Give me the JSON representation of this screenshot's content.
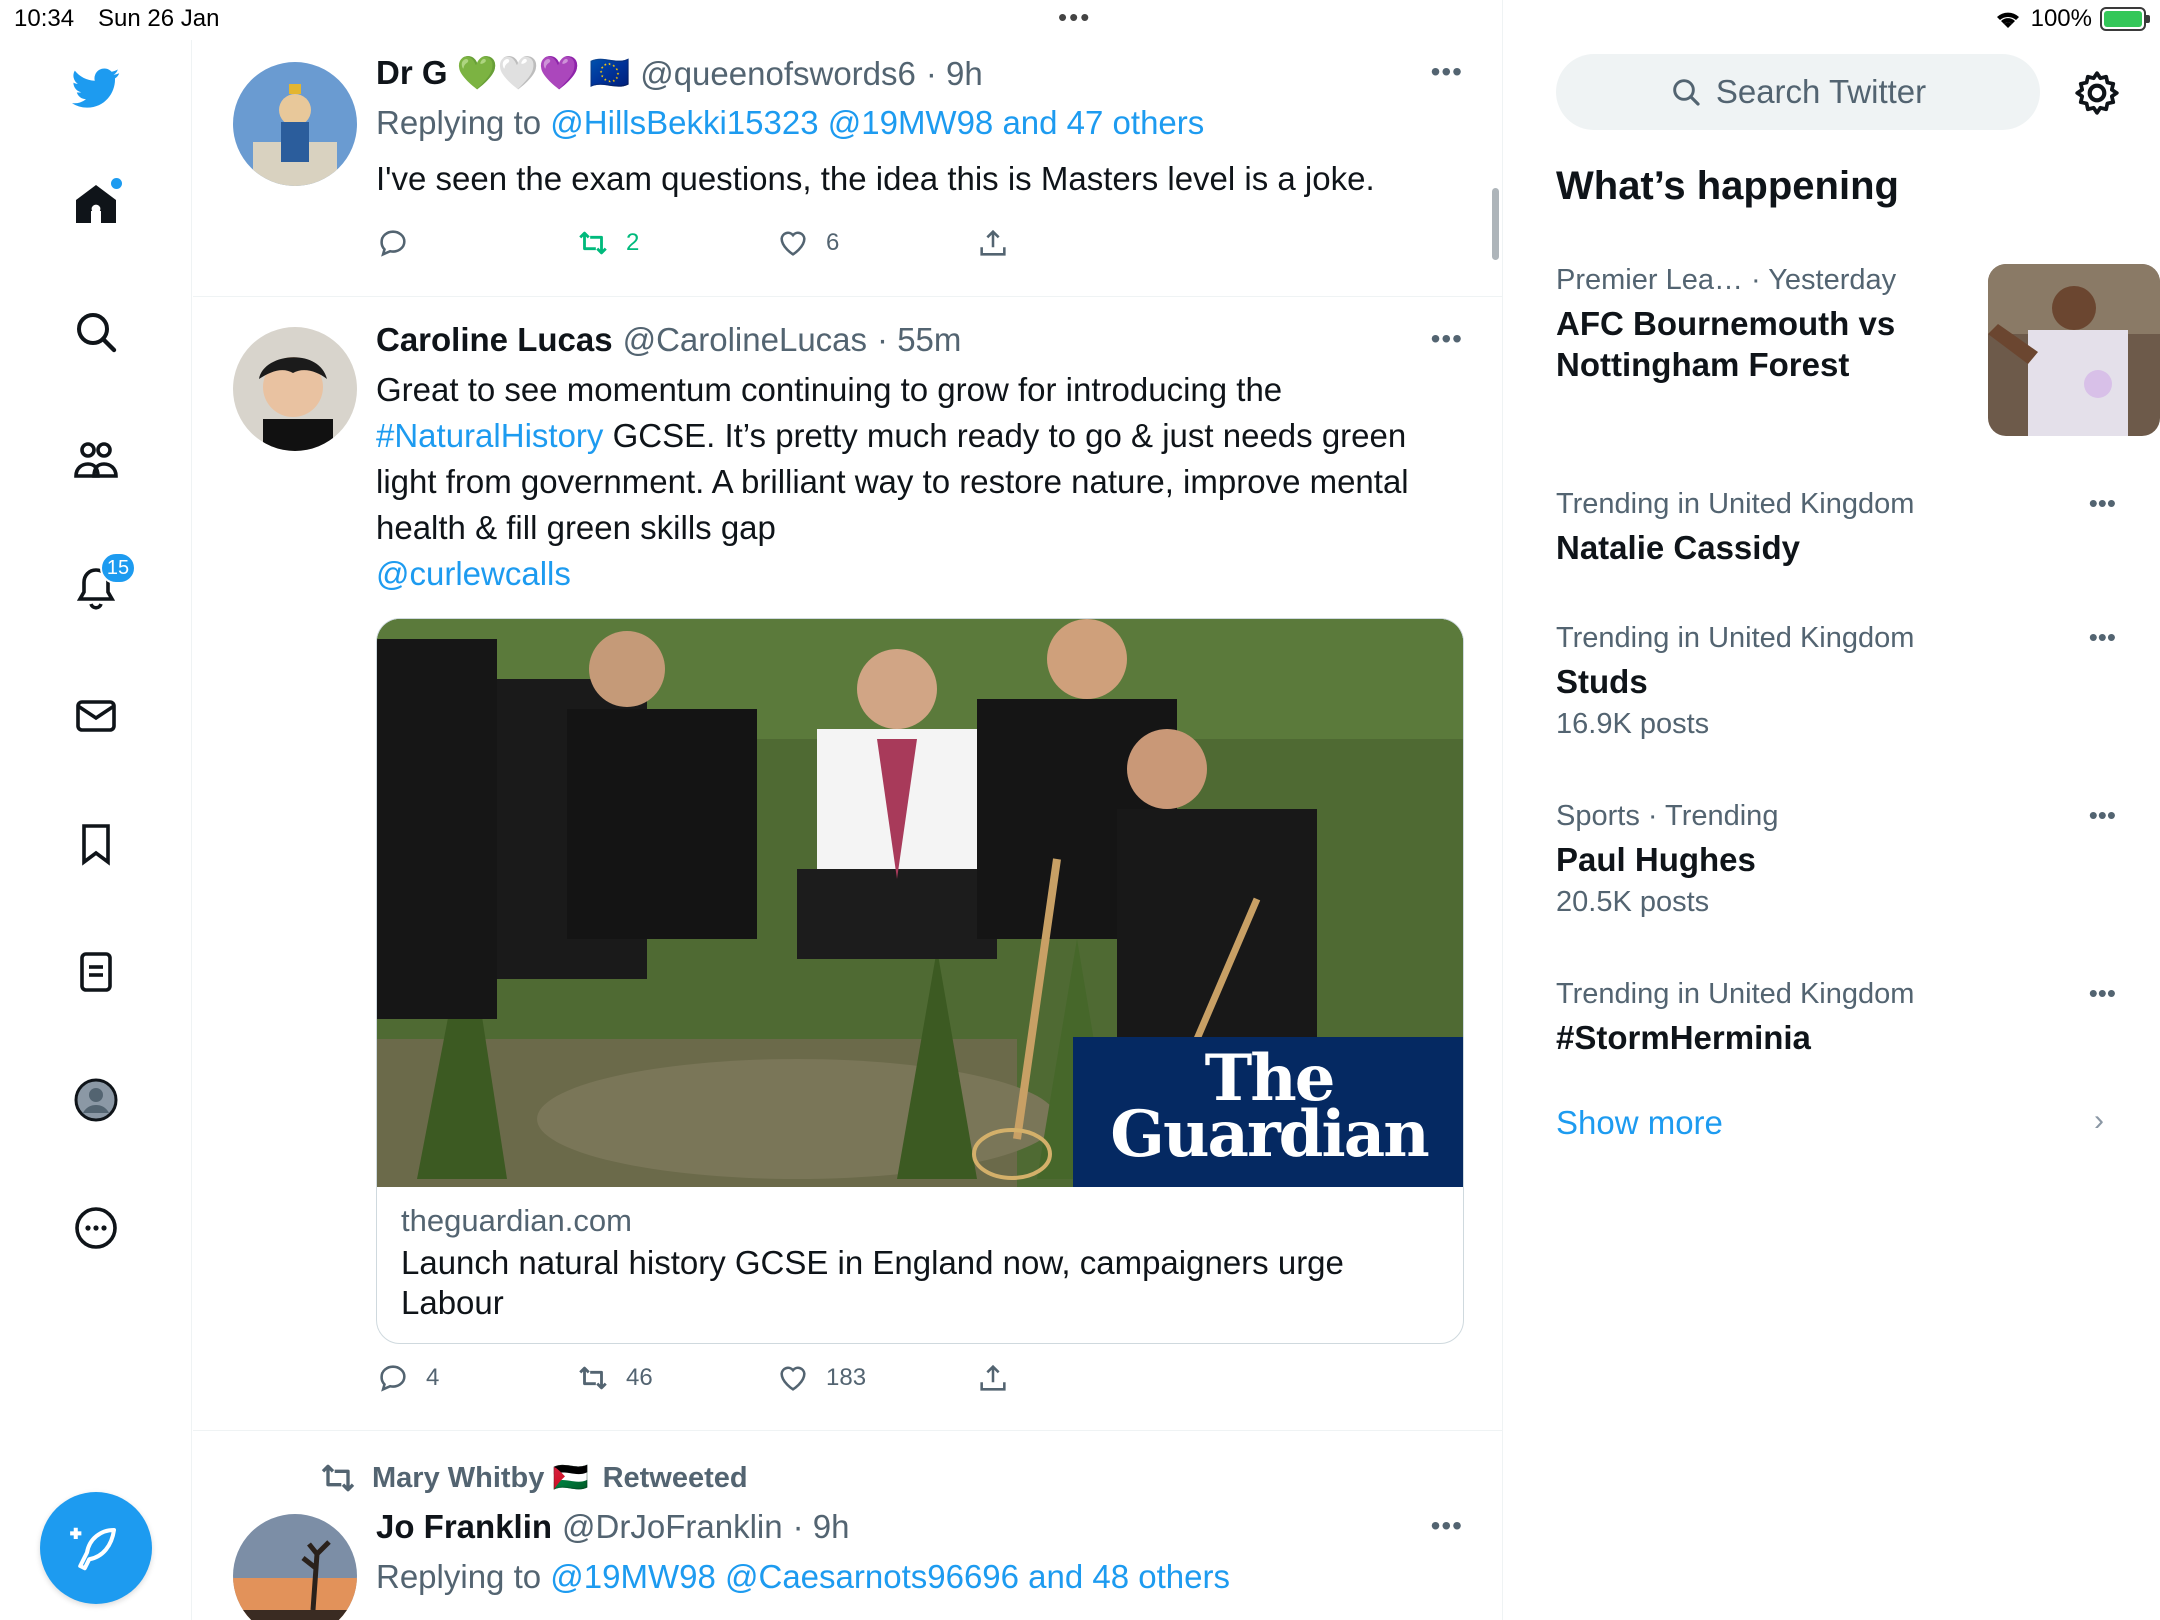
{
  "status_bar": {
    "time": "10:34",
    "date": "Sun 26 Jan",
    "battery": "100%"
  },
  "nav": {
    "notifications_count": "15"
  },
  "tweets": [
    {
      "name": "Dr G 💚🤍💜 🇪🇺",
      "handle": "@queenofswords6",
      "time": "· 9h",
      "replying_prefix": "Replying to",
      "replying_to": "@HillsBekki15323 @19MW98 and 47 others",
      "text": "I've seen the exam questions, the idea this is Masters level is a joke.",
      "replies": "",
      "retweets": "2",
      "likes": "6"
    },
    {
      "name": "Caroline Lucas",
      "handle": "@CarolineLucas",
      "time": "· 55m",
      "text_line1": "Great to see momentum continuing to grow for introducing the",
      "hashtag": "#NaturalHistory",
      "text_rest": " GCSE. It’s pretty much ready to go & just needs green light from government.  A brilliant way to restore nature, improve mental health & fill green skills gap",
      "mention": "@curlewcalls",
      "card": {
        "logo_line1": "The",
        "logo_line2": "Guardian",
        "domain": "theguardian.com",
        "title": "Launch natural history GCSE in England now, campaigners urge Labour"
      },
      "replies": "4",
      "retweets": "46",
      "likes": "183"
    },
    {
      "retweeted_by": "Mary Whitby 🇵🇸",
      "retweeted_label": "Retweeted",
      "name": "Jo Franklin",
      "handle": "@DrJoFranklin",
      "time": "· 9h",
      "replying_prefix": "Replying to",
      "replying_to": "@19MW98 @Caesarnots96696 and 48 others"
    }
  ],
  "sidebar": {
    "search_placeholder": "Search Twitter",
    "heading": "What’s happening",
    "trends": [
      {
        "category": "Premier Lea…",
        "time": "· Yesterday",
        "title": "AFC Bournemouth vs Nottingham Forest",
        "count": ""
      },
      {
        "category": "Trending in United Kingdom",
        "title": "Natalie Cassidy",
        "count": ""
      },
      {
        "category": "Trending in United Kingdom",
        "title": "Studs",
        "count": "16.9K posts"
      },
      {
        "category": "Sports · Trending",
        "title": "Paul Hughes",
        "count": "20.5K posts"
      },
      {
        "category": "Trending in United Kingdom",
        "title": "#StormHerminia",
        "count": ""
      }
    ],
    "show_more": "Show more"
  },
  "colors": {
    "accent": "#1d9bf0",
    "retweet_green": "#00ba7c",
    "guardian_blue": "#052962"
  }
}
